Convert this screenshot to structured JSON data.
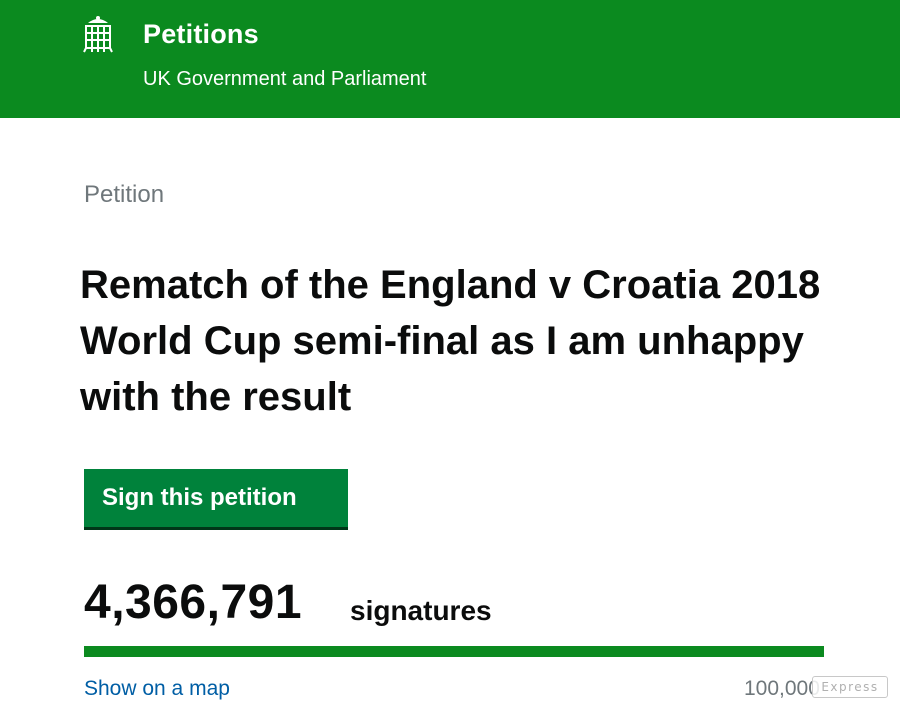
{
  "header": {
    "crest_icon": "portcullis-icon",
    "title": "Petitions",
    "subtitle": "UK Government and Parliament",
    "background_color": "#0b8a1f"
  },
  "petition": {
    "caption": "Petition",
    "title": "Rematch of the England v Croatia 2018 World Cup semi-final as I am unhappy with the result",
    "sign_button_label": "Sign this petition",
    "signature_count": "4,366,791",
    "signature_label": "signatures",
    "progress_fraction": 1.0,
    "show_map_label": "Show on a map",
    "threshold": "100,000"
  },
  "watermark": {
    "text": "Express"
  },
  "colors": {
    "brand_green": "#0b8a1f",
    "button_green": "#00823b",
    "link_blue": "#005ea5"
  }
}
